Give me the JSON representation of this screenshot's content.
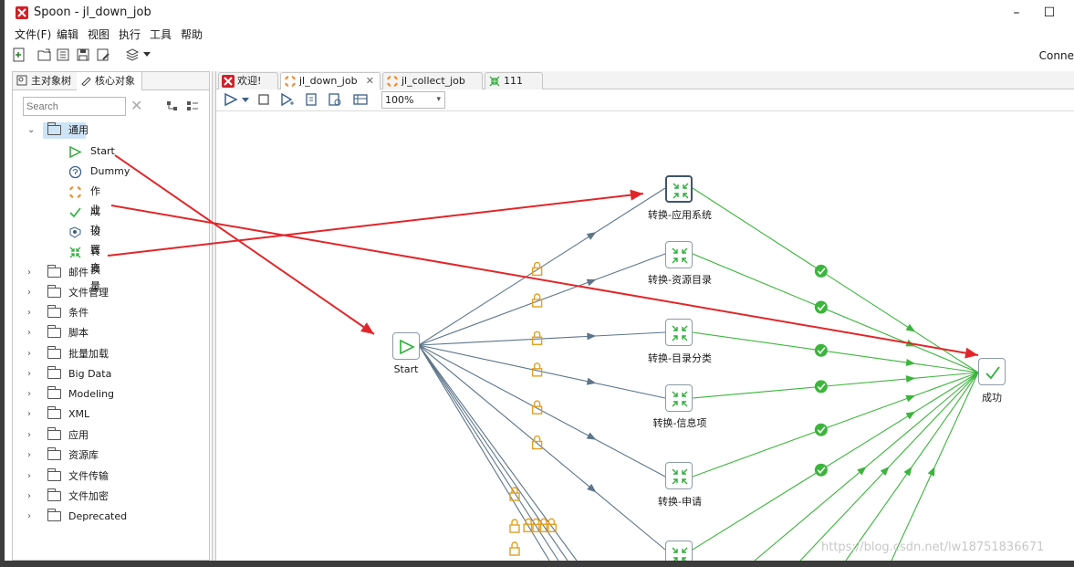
{
  "window": {
    "title": "Spoon - jl_down_job",
    "minimize": "–",
    "maximize": "☐"
  },
  "menu": [
    "文件(F)",
    "编辑",
    "视图",
    "执行",
    "工具",
    "帮助"
  ],
  "toolbar": {
    "connect": "Conne"
  },
  "left_panel": {
    "tabs": [
      {
        "label": "主对象树",
        "icon": "tree-icon"
      },
      {
        "label": "核心对象",
        "icon": "pencil-icon"
      }
    ],
    "search_placeholder": "Search",
    "tree": {
      "expanded_folder": "通用",
      "children": [
        {
          "label": "Start",
          "icon": "start-icon"
        },
        {
          "label": "Dummy",
          "icon": "dummy-icon"
        },
        {
          "label": "作业",
          "icon": "job-icon"
        },
        {
          "label": "成功",
          "icon": "success-icon"
        },
        {
          "label": "设置变量",
          "icon": "set-variable-icon"
        },
        {
          "label": "转换",
          "icon": "transformation-icon"
        }
      ],
      "folders": [
        "邮件",
        "文件管理",
        "条件",
        "脚本",
        "批量加载",
        "Big Data",
        "Modeling",
        "XML",
        "应用",
        "资源库",
        "文件传输",
        "文件加密",
        "Deprecated"
      ]
    }
  },
  "editor": {
    "tabs": [
      {
        "label": "欢迎!",
        "icon": "spoon-icon",
        "active": false
      },
      {
        "label": "jl_down_job",
        "icon": "job-icon",
        "active": true,
        "close": "✕"
      },
      {
        "label": "jl_collect_job",
        "icon": "job-icon",
        "active": false
      },
      {
        "label": "111",
        "icon": "transformation-icon",
        "active": false
      }
    ],
    "zoom": "100%"
  },
  "canvas": {
    "nodes": [
      {
        "id": "start",
        "label": "Start",
        "type": "start"
      },
      {
        "id": "t1",
        "label": "转换-应用系统",
        "type": "transformation",
        "selected": true
      },
      {
        "id": "t2",
        "label": "转换-资源目录",
        "type": "transformation"
      },
      {
        "id": "t3",
        "label": "转换-目录分类",
        "type": "transformation"
      },
      {
        "id": "t4",
        "label": "转换-信息项",
        "type": "transformation"
      },
      {
        "id": "t5",
        "label": "转换-申请",
        "type": "transformation"
      },
      {
        "id": "t6",
        "label": "",
        "type": "transformation"
      },
      {
        "id": "success",
        "label": "成功",
        "type": "success"
      }
    ]
  },
  "colors": {
    "hop_unconditional": "#5d7589",
    "hop_success": "#3bb53b",
    "annotation": "#e0262a",
    "lock": "#e3a020"
  },
  "watermark": "https://blog.csdn.net/lw18751836671"
}
